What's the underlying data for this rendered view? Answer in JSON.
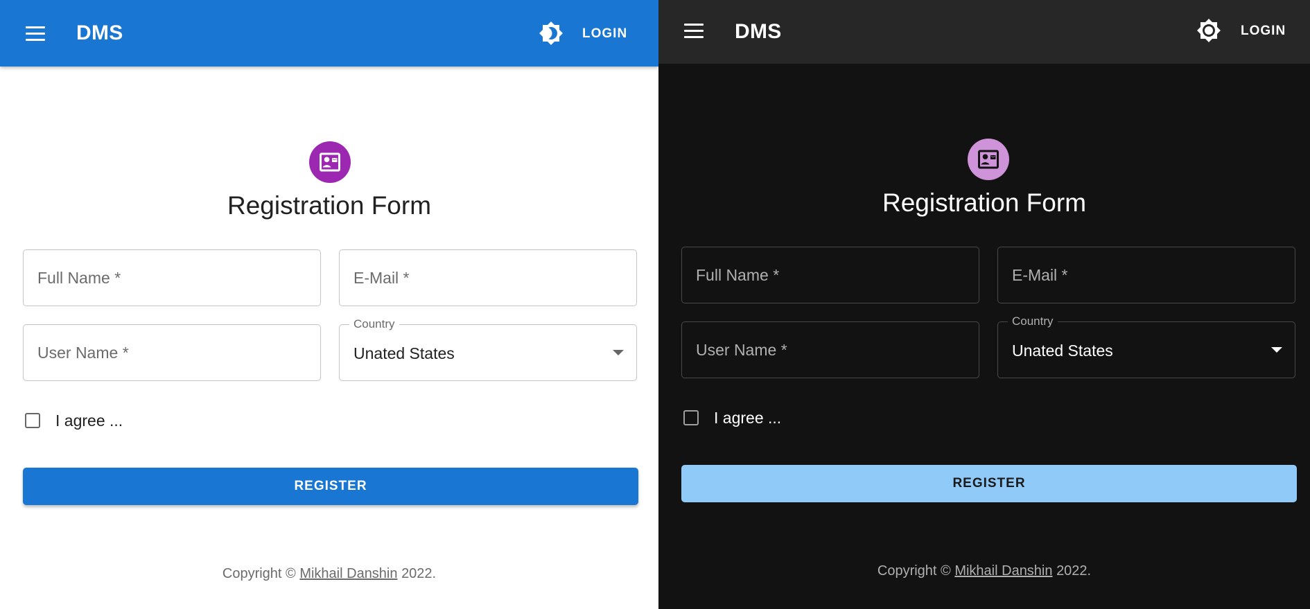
{
  "appbar": {
    "brand": "DMS",
    "login_label": "LOGIN",
    "theme_icon": "brightness-icon"
  },
  "form": {
    "title": "Registration Form",
    "avatar_icon": "contact-card-icon",
    "full_name_placeholder": "Full Name *",
    "email_placeholder": "E-Mail *",
    "user_name_placeholder": "User Name *",
    "country_label": "Country",
    "country_value": "Unated States",
    "agree_label": "I agree ...",
    "register_label": "REGISTER"
  },
  "footer": {
    "prefix": "Copyright ©",
    "author": "Mikhail Danshin",
    "year": "2022."
  },
  "colors": {
    "light_primary": "#1976d2",
    "light_avatar": "#9c27b0",
    "dark_background": "#121212",
    "dark_appbar": "#272727",
    "dark_primary": "#90caf9",
    "dark_avatar": "#ce93d8"
  }
}
